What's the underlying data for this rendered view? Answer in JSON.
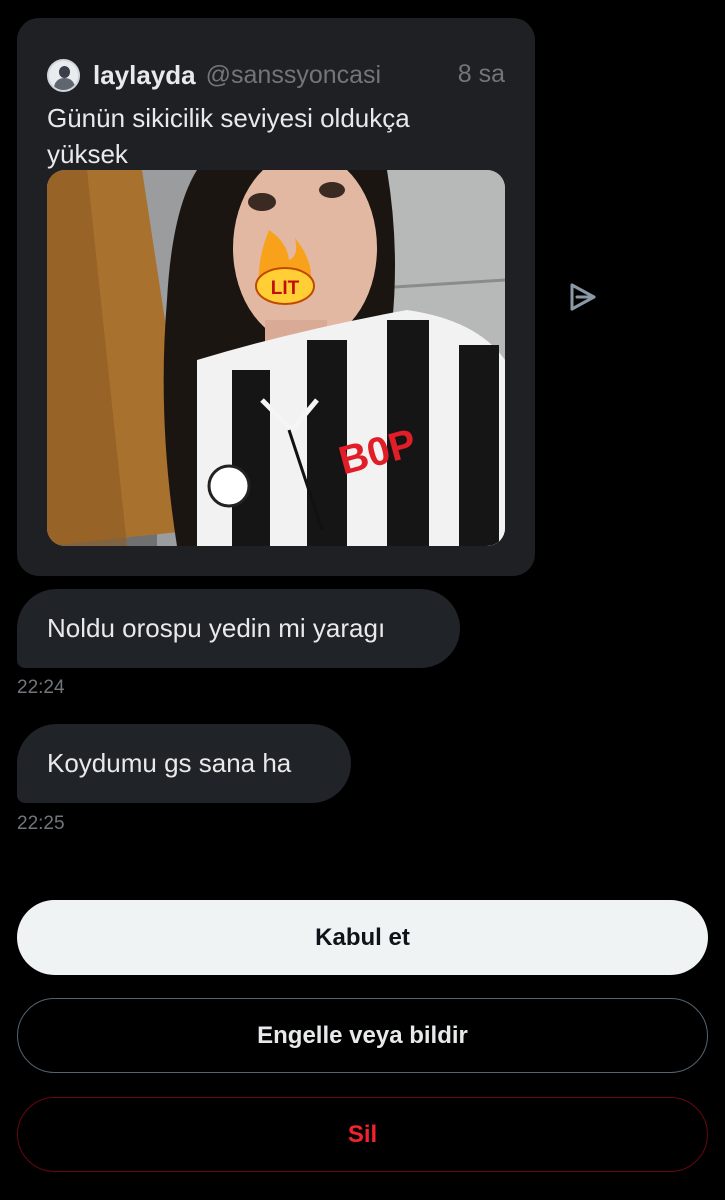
{
  "quote_tweet": {
    "display_name": "laylayda",
    "handle": "@sanssyoncasi",
    "time_ago": "8 sa",
    "text": "Günün sikicilik seviyesi oldukça yüksek",
    "media_icon": "photo",
    "sticker_text": "LIT"
  },
  "share_icon": "share-arrow-icon",
  "messages": [
    {
      "text": "Noldu orospu yedin mi yaragı",
      "time": "22:24"
    },
    {
      "text": "Koydumu gs sana ha",
      "time": "22:25"
    }
  ],
  "actions": {
    "accept_label": "Kabul et",
    "block_label": "Engelle veya bildir",
    "delete_label": "Sil"
  },
  "colors": {
    "background": "#000000",
    "bubble": "#202327",
    "card": "#1f2023",
    "muted_text": "#71767b",
    "danger": "#f4212e",
    "accept_button": "#eff3f4"
  }
}
